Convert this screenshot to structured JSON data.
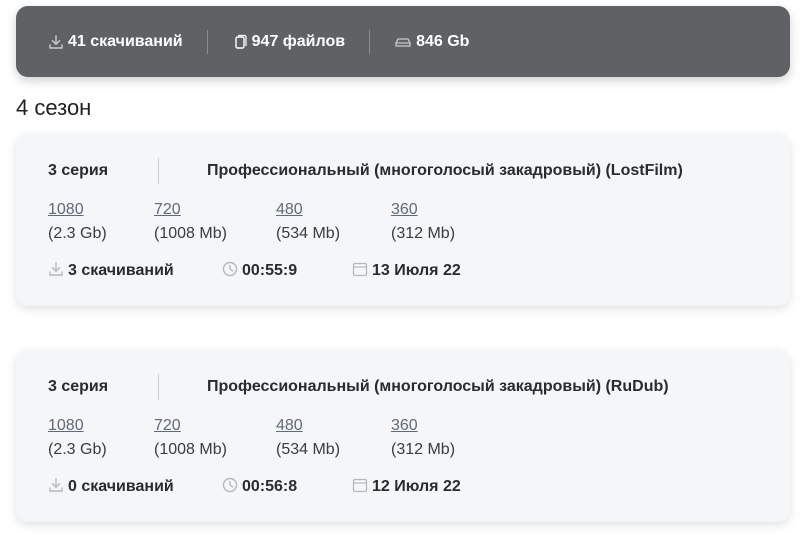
{
  "stats": {
    "downloads": "41 скачиваний",
    "files": "947 файлов",
    "size": "846 Gb"
  },
  "season_title": "4 сезон",
  "episodes": [
    {
      "episode": "3 серия",
      "translation": "Профессиональный (многоголосый закадровый) (LostFilm)",
      "qualities": [
        {
          "label": "1080",
          "size": "(2.3 Gb)"
        },
        {
          "label": "720",
          "size": "(1008 Mb)"
        },
        {
          "label": "480",
          "size": "(534 Mb)"
        },
        {
          "label": "360",
          "size": "(312 Mb)"
        }
      ],
      "downloads": "3 скачиваний",
      "duration": "00:55:9",
      "date": "13 Июля 22"
    },
    {
      "episode": "3 серия",
      "translation": "Профессиональный (многоголосый закадровый) (RuDub)",
      "qualities": [
        {
          "label": "1080",
          "size": "(2.3 Gb)"
        },
        {
          "label": "720",
          "size": "(1008 Mb)"
        },
        {
          "label": "480",
          "size": "(534 Mb)"
        },
        {
          "label": "360",
          "size": "(312 Mb)"
        }
      ],
      "downloads": "0 скачиваний",
      "duration": "00:56:8",
      "date": "12 Июля 22"
    }
  ],
  "colors": {
    "stats_bg": "#5f6164",
    "card_bg": "#f5f6f8",
    "link": "#606a76",
    "icon": "#b4b7bc"
  },
  "icons": [
    "download-icon",
    "file-icon",
    "drive-icon",
    "clock-icon",
    "calendar-icon"
  ]
}
